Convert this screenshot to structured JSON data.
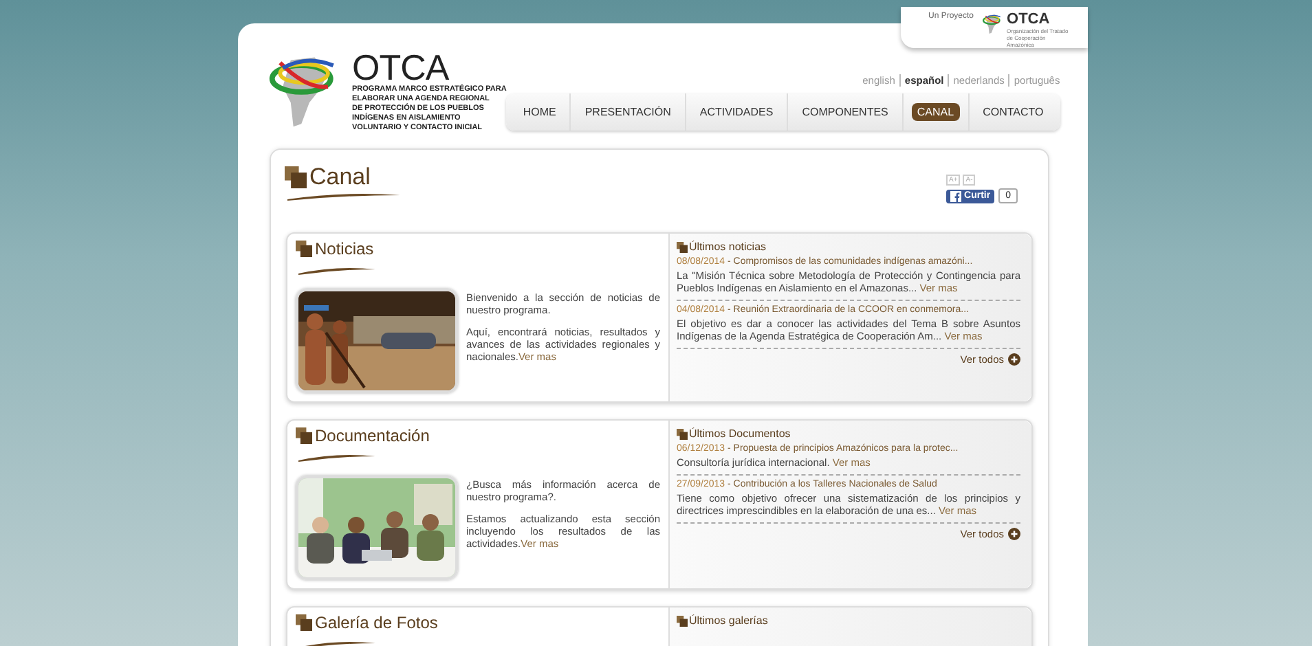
{
  "project_tab": {
    "label": "Un Proyecto",
    "logo_text": "OTCA",
    "logo_subtitle": "Organización del Tratado de Cooperación Amazónica"
  },
  "logo": {
    "name": "OTCA",
    "subtitle_lines": [
      "PROGRAMA MARCO ESTRATÉGICO PARA",
      "ELABORAR UNA AGENDA REGIONAL",
      "DE PROTECCIÓN DE LOS PUEBLOS",
      "INDÍGENAS EN AISLAMIENTO",
      "VOLUNTARIO Y CONTACTO INICIAL"
    ]
  },
  "languages": [
    {
      "label": "english",
      "selected": false
    },
    {
      "label": "español",
      "selected": true
    },
    {
      "label": "nederlands",
      "selected": false
    },
    {
      "label": "português",
      "selected": false
    }
  ],
  "nav": [
    {
      "label": "HOME",
      "selected": false
    },
    {
      "label": "PRESENTACIÓN",
      "selected": false
    },
    {
      "label": "ACTIVIDADES",
      "selected": false
    },
    {
      "label": "COMPONENTES",
      "selected": false
    },
    {
      "label": "CANAL",
      "selected": true
    },
    {
      "label": "CONTACTO",
      "selected": false
    }
  ],
  "page_title": "Canal",
  "font_buttons": [
    "A+",
    "A-"
  ],
  "like_button": {
    "label": "Curtir",
    "count": "0"
  },
  "sections": [
    {
      "title": "Noticias",
      "picture": {
        "kind": "picture"
      },
      "paragraphs": [
        "Bienvenido a la sección de noticias de nuestro programa.",
        "Aquí, encontrará noticias, resultados y avances de las actividades regionales y nacionales."
      ],
      "link": "Ver mas",
      "list_title": "Últimos noticias",
      "items": [
        {
          "date": "08/08/2014",
          "title": "- Compromisos de las comunidades indígenas amazóni...",
          "summary": "La \"Misión Técnica sobre Metodología de Protección y Contingencia para Pueblos Indígenas en Aislamiento en el Amazonas...",
          "link": "Ver mas"
        },
        {
          "date": "04/08/2014",
          "title": "- Reunión Extraordinaria de la CCOOR en conmemora...",
          "summary": "El objetivo es dar a conocer las actividades del Tema B sobre Asuntos Indígenas de la Agenda Estratégica de Cooperación Am...",
          "link": "Ver mas"
        }
      ],
      "more": "Ver todos"
    },
    {
      "title": "Documentación",
      "picture": {
        "kind": "picture"
      },
      "paragraphs": [
        "¿Busca más información acerca de nuestro programa?.",
        "Estamos actualizando esta sección incluyendo los resultados de las actividades."
      ],
      "link": "Ver mas",
      "list_title": "Últimos Documentos",
      "items": [
        {
          "date": "06/12/2013",
          "title": "- Propuesta de principios Amazónicos para la protec...",
          "summary": "Consultoría jurídica internacional.",
          "link": "Ver mas"
        },
        {
          "date": "27/09/2013",
          "title": "- Contribución a los Talleres Nacionales de Salud",
          "summary": "Tiene como objetivo ofrecer una sistematización de los principios y directrices imprescindibles en la elaboración de una es...",
          "link": "Ver mas"
        }
      ],
      "more": "Ver todos"
    },
    {
      "title": "Galería de Fotos",
      "list_title": "Últimos galerías"
    }
  ]
}
